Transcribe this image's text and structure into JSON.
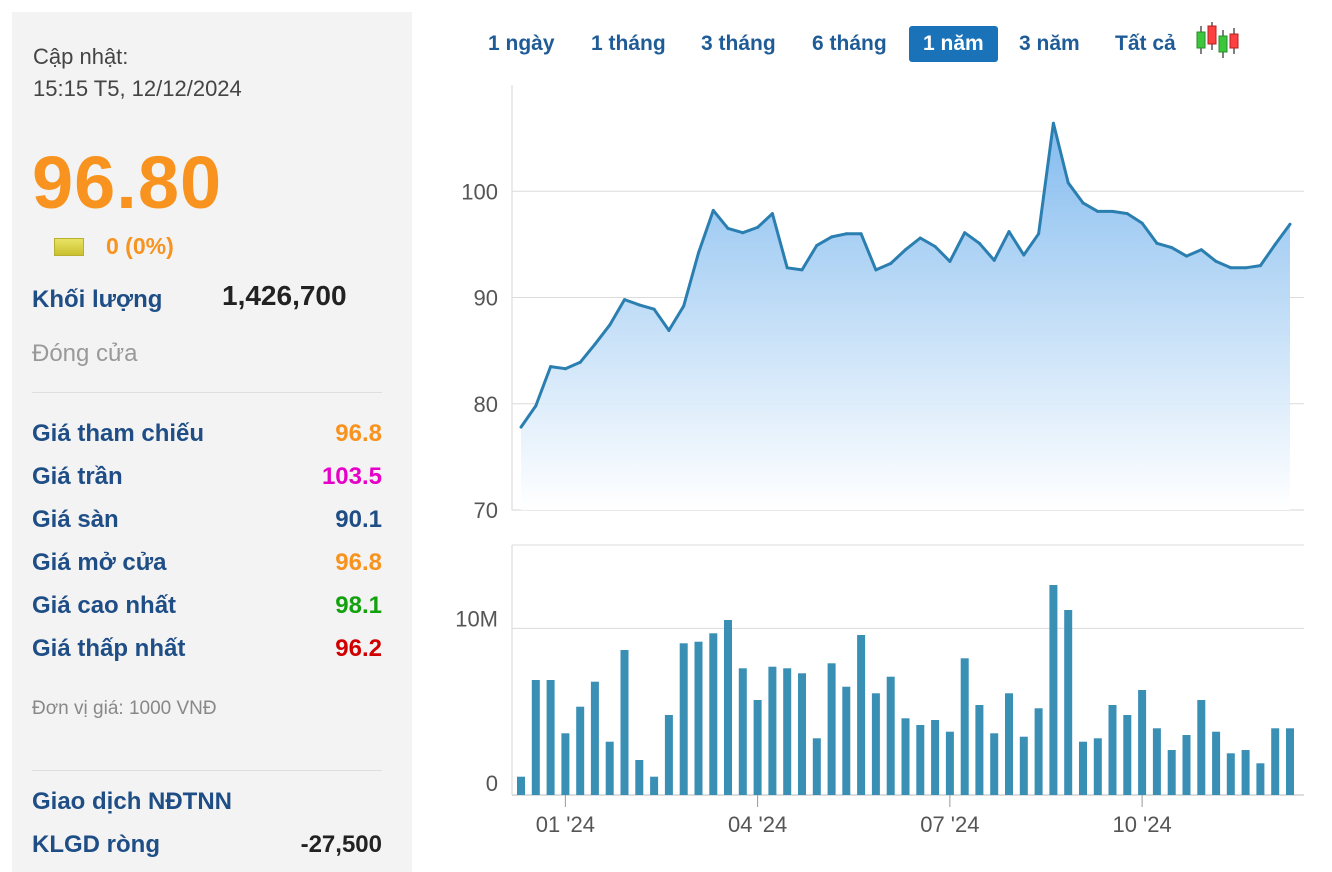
{
  "quote": {
    "updated_label": "Cập nhật:",
    "updated_time": "15:15 T5, 12/12/2024",
    "price": "96.80",
    "change": "0 (0%)",
    "volume_label": "Khối lượng",
    "volume": "1,426,700",
    "status": "Đóng cửa",
    "unit": "Đơn vị giá: 1000 VNĐ",
    "colors": {
      "accent": "#f7931e",
      "label": "#1f4e86"
    },
    "stats": [
      {
        "label": "Giá tham chiếu",
        "value": "96.8",
        "color": "#f7931e"
      },
      {
        "label": "Giá trần",
        "value": "103.5",
        "color": "#e600c8"
      },
      {
        "label": "Giá sàn",
        "value": "90.1",
        "color": "#1f4e86"
      },
      {
        "label": "Giá mở cửa",
        "value": "96.8",
        "color": "#f7931e"
      },
      {
        "label": "Giá cao nhất",
        "value": "98.1",
        "color": "#13a10e"
      },
      {
        "label": "Giá thấp nhất",
        "value": "96.2",
        "color": "#d00000"
      }
    ],
    "foreign": {
      "title": "Giao dịch NĐTNN",
      "net_label": "KLGD ròng",
      "net_value": "-27,500"
    }
  },
  "range_tabs": [
    {
      "label": "1 ngày",
      "active": false
    },
    {
      "label": "1 tháng",
      "active": false
    },
    {
      "label": "3 tháng",
      "active": false
    },
    {
      "label": "6 tháng",
      "active": false
    },
    {
      "label": "1 năm",
      "active": true
    },
    {
      "label": "3 năm",
      "active": false
    },
    {
      "label": "Tất cả",
      "active": false
    }
  ],
  "candle_icon": "candlestick-icon",
  "chart_data": [
    {
      "type": "area",
      "title": "",
      "ylim": [
        70,
        110
      ],
      "yticks": [
        "70",
        "80",
        "90",
        "100"
      ],
      "color": "#2b7fb0",
      "fill_top": "#7db8ee",
      "values": [
        77.8,
        79.8,
        83.5,
        83.3,
        83.9,
        85.6,
        87.4,
        89.8,
        89.3,
        88.9,
        86.9,
        89.2,
        94.2,
        98.2,
        96.5,
        96.1,
        96.6,
        97.9,
        92.8,
        92.6,
        94.9,
        95.7,
        96,
        96,
        92.6,
        93.2,
        94.5,
        95.6,
        94.8,
        93.4,
        96.1,
        95.1,
        93.5,
        96.2,
        94,
        96,
        106.4,
        100.8,
        98.9,
        98.1,
        98.1,
        97.9,
        97,
        95.1,
        94.7,
        93.9,
        94.5,
        93.4,
        92.8,
        92.8,
        93,
        95,
        96.9
      ]
    },
    {
      "type": "bar",
      "title": "",
      "ylim": [
        0,
        15
      ],
      "yticks": [
        "0",
        "10M"
      ],
      "color": "#3a8fb5",
      "values": [
        1.1,
        6.9,
        6.9,
        3.7,
        5.3,
        6.8,
        3.2,
        8.7,
        2.1,
        1.1,
        4.8,
        9.1,
        9.2,
        9.7,
        10.5,
        7.6,
        5.7,
        7.7,
        7.6,
        7.3,
        3.4,
        7.9,
        6.5,
        9.6,
        6.1,
        7.1,
        4.6,
        4.2,
        4.5,
        3.8,
        8.2,
        5.4,
        3.7,
        6.1,
        3.5,
        5.2,
        12.6,
        11.1,
        3.2,
        3.4,
        5.4,
        4.8,
        6.3,
        4,
        2.7,
        3.6,
        5.7,
        3.8,
        2.5,
        2.7,
        1.9,
        4,
        4
      ],
      "xticks": [
        "01 '24",
        "04 '24",
        "07 '24",
        "10 '24"
      ]
    }
  ]
}
